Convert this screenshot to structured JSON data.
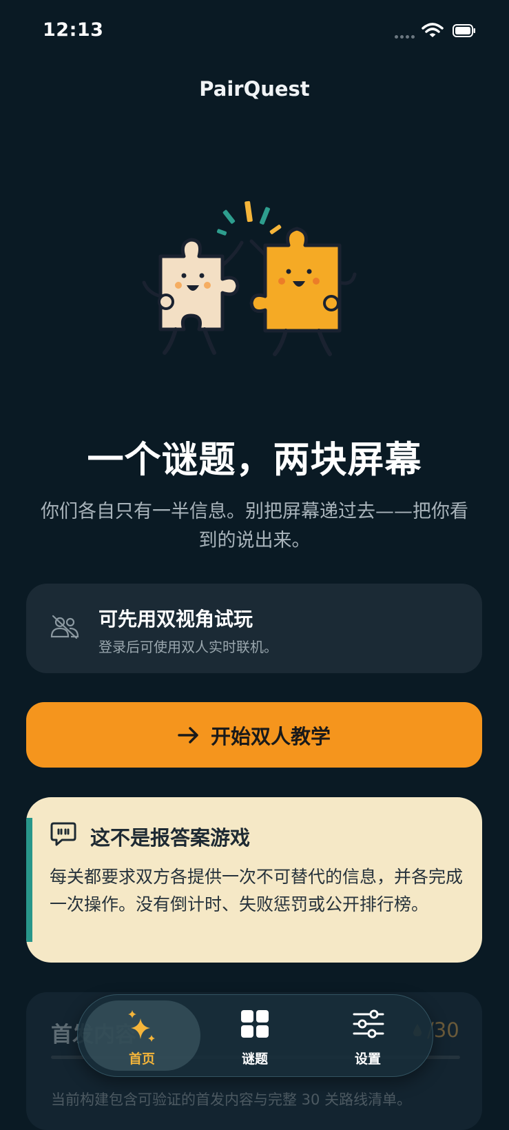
{
  "status_bar": {
    "time": "12:13"
  },
  "header": {
    "title": "PairQuest"
  },
  "hero": {
    "headline": "一个谜题，两块屏幕",
    "subtitle": "你们各自只有一半信息。别把屏幕递过去——把你看到的说出来。"
  },
  "notice": {
    "title": "可先用双视角试玩",
    "subtitle": "登录后可使用双人实时联机。",
    "icon": "users-offline-icon"
  },
  "cta": {
    "label": "开始双人教学",
    "icon": "arrow-right-icon"
  },
  "info": {
    "title": "这不是报答案游戏",
    "body": "每关都要求双方各提供一次不可替代的信息，并各完成一次操作。没有倒计时、失败惩罚或公开排行榜。",
    "icon": "speech-quote-icon"
  },
  "progress": {
    "title": "首发内容",
    "count": "/30",
    "note": "当前构建包含可验证的首发内容与完整 30 关路线清单。"
  },
  "tabs": [
    {
      "label": "首页",
      "icon": "sparkles-icon",
      "active": true
    },
    {
      "label": "谜题",
      "icon": "grid-icon",
      "active": false
    },
    {
      "label": "设置",
      "icon": "sliders-icon",
      "active": false
    }
  ],
  "colors": {
    "background": "#0a1a24",
    "accent": "#f5951d",
    "card": "#1b2a35",
    "info_card": "#f5e8c6",
    "teal": "#28968a",
    "tab_active": "#f5b53a"
  }
}
